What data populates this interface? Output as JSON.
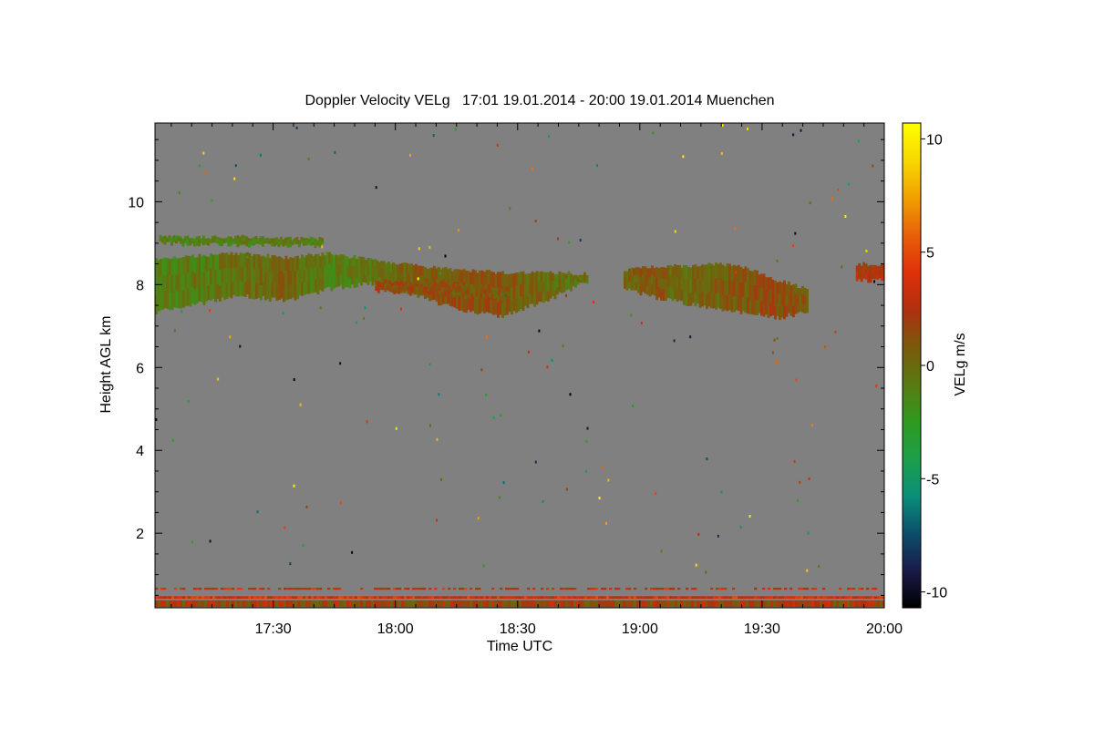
{
  "chart_data": {
    "type": "heatmap",
    "title": "Doppler Velocity VELg   17:01 19.01.2014 - 20:00 19.01.2014 Muenchen",
    "xlabel": "Time UTC",
    "ylabel": "Height AGL km",
    "colorbar_label": "VELg m/s",
    "x_unit": "time of day (UTC)",
    "xlim": [
      "17:01",
      "20:00"
    ],
    "ylim": [
      0.2,
      11.9
    ],
    "color_range": [
      -10.7,
      10.7
    ],
    "x_ticks": [
      "17:30",
      "18:00",
      "18:30",
      "19:00",
      "19:30",
      "20:00"
    ],
    "y_ticks": [
      2,
      4,
      6,
      8,
      10
    ],
    "colorbar_ticks": [
      -10,
      -5,
      0,
      5,
      10
    ],
    "background_color": "#808080",
    "colormap": [
      "#000000",
      "#1a1a4a",
      "#0b4f6b",
      "#0b8f7a",
      "#1d9f4a",
      "#2f9a1e",
      "#5a7a12",
      "#7a5a0c",
      "#b03010",
      "#e0300a",
      "#e86008",
      "#f0a000",
      "#f8d800",
      "#ffff00"
    ],
    "cloud_layers": [
      {
        "t_start": "17:01",
        "t_end": "18:47",
        "base_km": [
          7.35,
          7.55,
          7.75,
          7.6,
          7.9,
          8.05,
          7.75,
          7.4,
          7.25,
          7.6,
          8.1
        ],
        "top_km": [
          8.6,
          8.7,
          8.75,
          8.65,
          8.75,
          8.6,
          8.45,
          8.35,
          8.3,
          8.3,
          8.25
        ],
        "velocity_ms": [
          -1.2,
          -0.8,
          -0.3,
          0.4,
          -1.0,
          -0.6,
          0.8,
          1.3,
          1.0,
          0.2,
          -0.5
        ]
      },
      {
        "t_start": "18:56",
        "t_end": "19:41",
        "base_km": [
          7.9,
          7.7,
          7.55,
          7.45,
          7.3,
          7.2,
          7.35
        ],
        "top_km": [
          8.35,
          8.45,
          8.45,
          8.5,
          8.4,
          8.1,
          7.9
        ],
        "velocity_ms": [
          0.6,
          0.9,
          -0.2,
          0.5,
          1.1,
          1.4,
          0.9
        ]
      },
      {
        "t_start": "17:02",
        "t_end": "17:42",
        "base_km": [
          9.0,
          8.95,
          8.95
        ],
        "top_km": [
          9.15,
          9.15,
          9.1
        ],
        "velocity_ms": [
          -1.1,
          -0.9,
          -1.0
        ]
      },
      {
        "t_start": "17:55",
        "t_end": "18:28",
        "base_km": [
          7.85,
          7.75,
          7.65
        ],
        "top_km": [
          8.1,
          8.0,
          7.95
        ],
        "velocity_ms": [
          1.5,
          1.2,
          0.8
        ]
      },
      {
        "t_start": "19:53",
        "t_end": "20:00",
        "base_km": [
          8.1,
          8.1
        ],
        "top_km": [
          8.5,
          8.5
        ],
        "velocity_ms": [
          2.5,
          2.5
        ]
      }
    ],
    "near_surface_layers": [
      {
        "height_km": 0.3,
        "thickness_km": 0.16,
        "velocity_ms": 1.8
      },
      {
        "height_km": 0.45,
        "thickness_km": 0.06,
        "velocity_ms": 3.5
      },
      {
        "height_km": 0.66,
        "thickness_km": 0.05,
        "velocity_ms": 3.0
      }
    ]
  }
}
